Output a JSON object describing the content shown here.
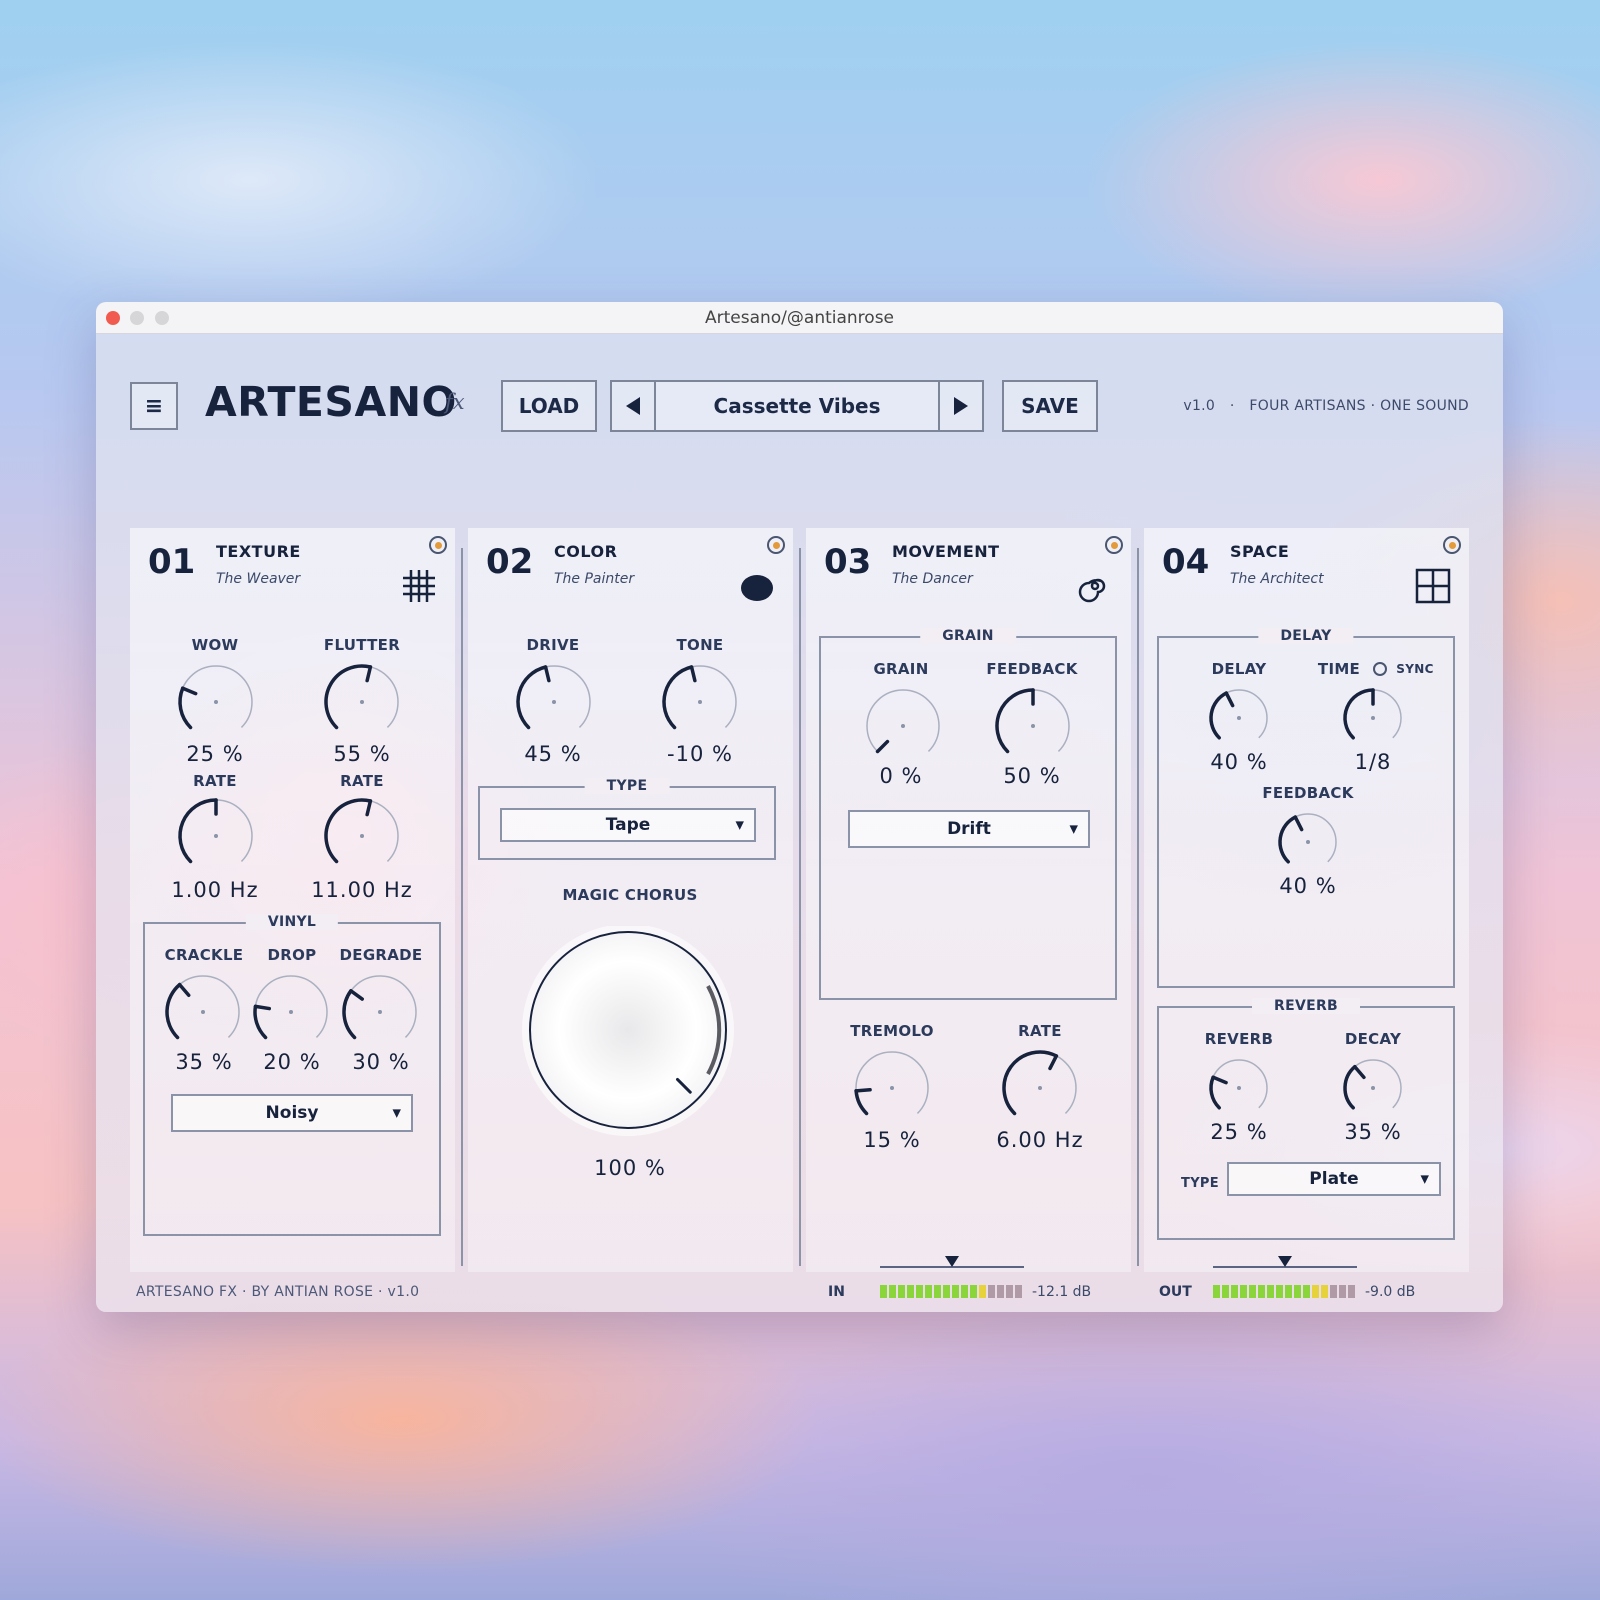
{
  "window": {
    "title": "Artesano/@antianrose"
  },
  "header": {
    "menu_icon": "hamburger-icon",
    "menu_glyph": "≡",
    "brand": "ARTESANO",
    "brand_suffix": "fx",
    "load_label": "LOAD",
    "preset_name": "Cassette Vibes",
    "save_label": "SAVE",
    "version": "v1.0",
    "separator": "·",
    "tagline": "FOUR ARTISANS · ONE SOUND"
  },
  "colors": {
    "ink": "#17223d",
    "power_dot": "#e29a3a",
    "meter_green": "#8ad63a",
    "meter_yellow": "#e6d23a",
    "meter_off": "#b09aa6"
  },
  "panels": {
    "texture": {
      "number": "01",
      "name": "TEXTURE",
      "subtitle": "The Weaver",
      "icon": "grid-hash-icon",
      "wow": {
        "label": "WOW",
        "value": "25 %",
        "level": 0.25
      },
      "flutter": {
        "label": "FLUTTER",
        "value": "55 %",
        "level": 0.55
      },
      "wow_rate": {
        "label": "RATE",
        "value": "1.00 Hz",
        "level": 0.5
      },
      "flutter_rate": {
        "label": "RATE",
        "value": "11.00 Hz",
        "level": 0.55
      },
      "vinyl": {
        "title": "VINYL",
        "crackle": {
          "label": "CRACKLE",
          "value": "35 %",
          "level": 0.35
        },
        "drop": {
          "label": "DROP",
          "value": "20 %",
          "level": 0.2
        },
        "degrade": {
          "label": "DEGRADE",
          "value": "30 %",
          "level": 0.3
        },
        "mode": "Noisy"
      }
    },
    "color": {
      "number": "02",
      "name": "COLOR",
      "subtitle": "The Painter",
      "icon": "paint-blob-icon",
      "drive": {
        "label": "DRIVE",
        "value": "45 %",
        "level": 0.45
      },
      "tone": {
        "label": "TONE",
        "value": "-10 %",
        "level": 0.45
      },
      "type": {
        "title": "TYPE",
        "value": "Tape"
      },
      "chorus": {
        "label": "MAGIC CHORUS",
        "value": "100 %",
        "level": 1.0
      }
    },
    "movement": {
      "number": "03",
      "name": "MOVEMENT",
      "subtitle": "The Dancer",
      "icon": "spiral-icon",
      "grain_group": {
        "title": "GRAIN",
        "grain": {
          "label": "GRAIN",
          "value": "0 %",
          "level": 0.0
        },
        "feedback": {
          "label": "FEEDBACK",
          "value": "50 %",
          "level": 0.5
        },
        "mode": "Drift"
      },
      "tremolo": {
        "label": "TREMOLO",
        "value": "15 %",
        "level": 0.15
      },
      "rate": {
        "label": "RATE",
        "value": "6.00 Hz",
        "level": 0.6
      }
    },
    "space": {
      "number": "04",
      "name": "SPACE",
      "subtitle": "The Architect",
      "icon": "window-grid-icon",
      "delay_group": {
        "title": "DELAY",
        "delay": {
          "label": "DELAY",
          "value": "40 %",
          "level": 0.4
        },
        "time": {
          "label": "TIME",
          "value": "1/8",
          "level": 0.5
        },
        "sync_label": "SYNC",
        "feedback": {
          "label": "FEEDBACK",
          "value": "40 %",
          "level": 0.4
        }
      },
      "reverb_group": {
        "title": "REVERB",
        "reverb": {
          "label": "REVERB",
          "value": "25 %",
          "level": 0.25
        },
        "decay": {
          "label": "DECAY",
          "value": "35 %",
          "level": 0.35
        },
        "type_label": "TYPE",
        "type_value": "Plate"
      }
    }
  },
  "footer": {
    "credit": "ARTESANO FX  ·  BY ANTIAN ROSE  ·  v1.0",
    "in": {
      "label": "IN",
      "value": "-12.1 dB",
      "lit": 12,
      "yellow": 1,
      "total": 16,
      "trim_level": 0.5
    },
    "out": {
      "label": "OUT",
      "value": "-9.0 dB",
      "lit": 13,
      "yellow": 2,
      "total": 16,
      "trim_level": 0.5
    }
  }
}
